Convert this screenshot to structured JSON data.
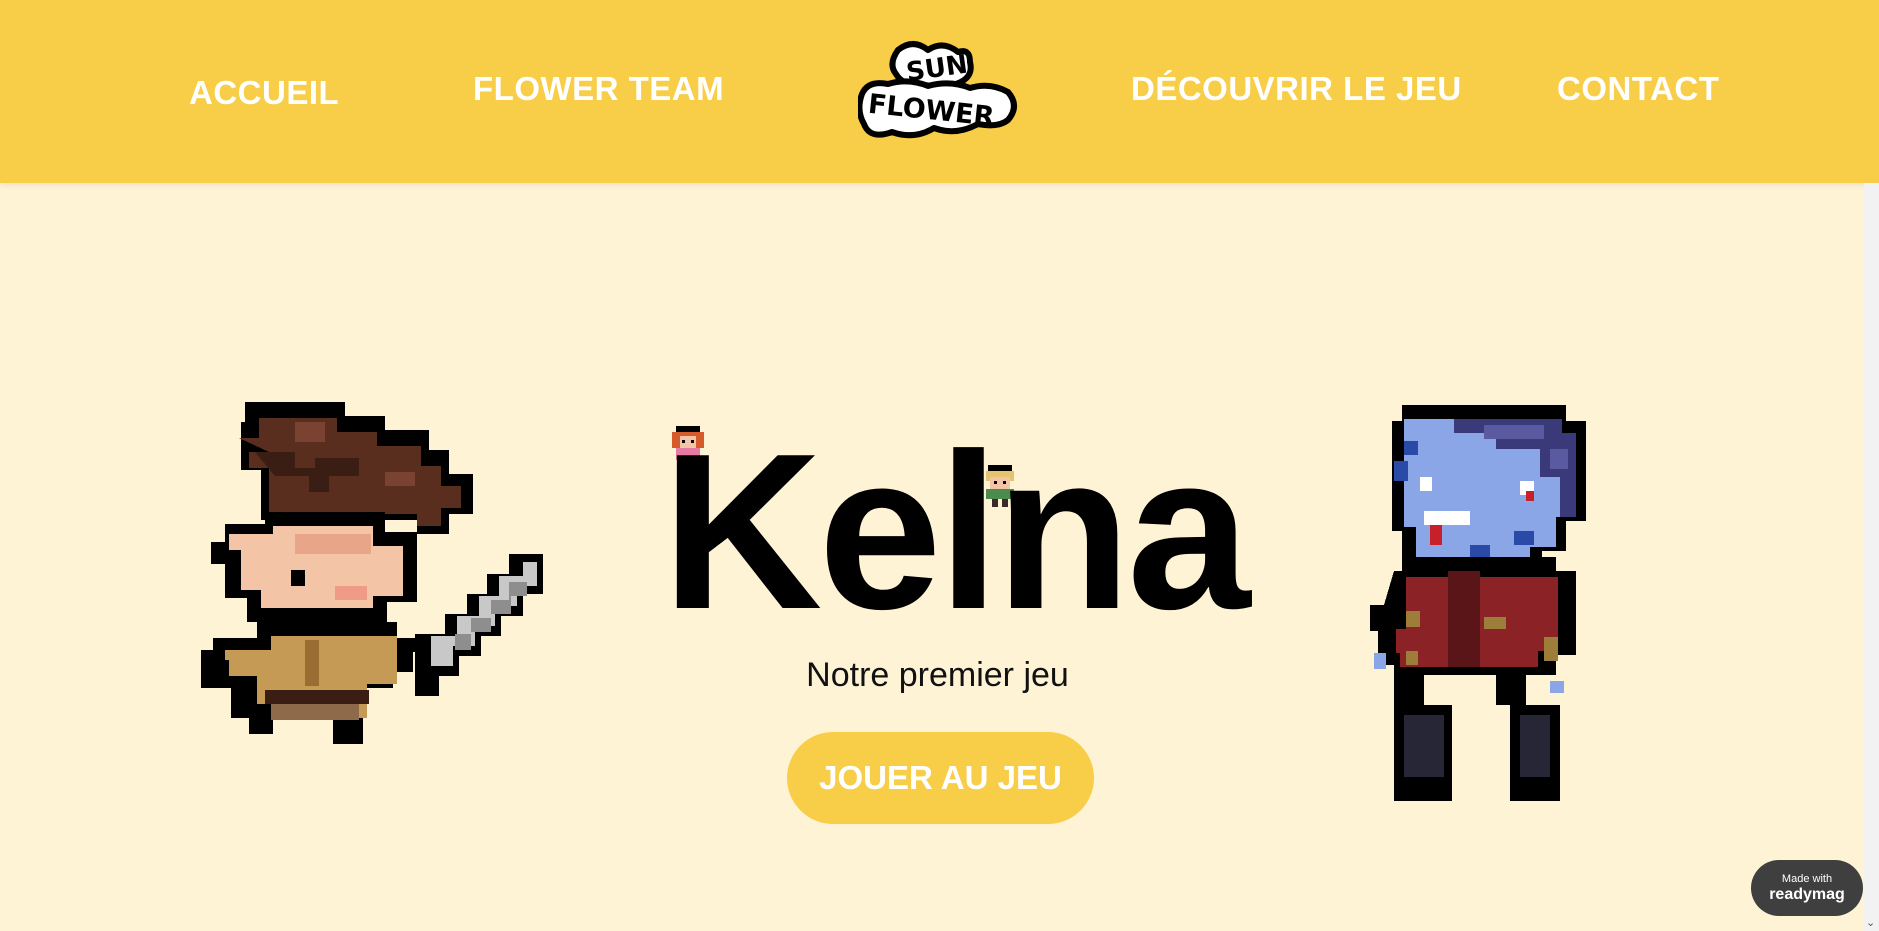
{
  "nav": {
    "items": [
      {
        "label": "ACCUEIL"
      },
      {
        "label": "FLOWER TEAM"
      },
      {
        "label": "DÉCOUVRIR LE JEU"
      },
      {
        "label": "CONTACT"
      }
    ],
    "logo_text": [
      "SUN",
      "FLOWER"
    ]
  },
  "hero": {
    "title": "Kelna",
    "subtitle": "Notre premier jeu",
    "cta_label": "JOUER AU JEU"
  },
  "badge": {
    "line1": "Made with",
    "line2": "readymag"
  },
  "colors": {
    "header_bg": "#F8CD47",
    "page_bg": "#FFF3D6",
    "accent": "#F8CD47",
    "text": "#000000"
  },
  "icons": [
    "sun-flower-logo",
    "warrior-character",
    "zombie-character",
    "girl-sprite",
    "boy-sprite",
    "scroll-down-arrow-icon"
  ]
}
